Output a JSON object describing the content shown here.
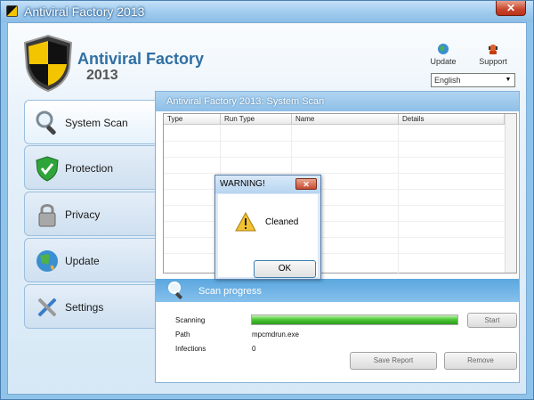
{
  "window": {
    "title": "Antiviral Factory 2013",
    "close_glyph": "✕"
  },
  "brand": {
    "name": "Antiviral Factory",
    "year": "2013",
    "icon": "shield-logo"
  },
  "top_buttons": {
    "update": {
      "label": "Update",
      "icon": "globe-icon"
    },
    "support": {
      "label": "Support",
      "icon": "support-icon"
    }
  },
  "language": {
    "selected": "English"
  },
  "sidebar": {
    "items": [
      {
        "label": "System Scan",
        "icon": "magnifier-icon",
        "active": true
      },
      {
        "label": "Protection",
        "icon": "shield-check-icon",
        "active": false
      },
      {
        "label": "Privacy",
        "icon": "lock-icon",
        "active": false
      },
      {
        "label": "Update",
        "icon": "globe-icon",
        "active": false
      },
      {
        "label": "Settings",
        "icon": "tools-icon",
        "active": false
      }
    ]
  },
  "panel": {
    "title": "Antiviral Factory 2013: System Scan",
    "columns": [
      "Type",
      "Run Type",
      "Name",
      "Details"
    ]
  },
  "progress": {
    "title": "Scan progress",
    "scanning_label": "Scanning",
    "path_label": "Path",
    "path_value": "mpcmdrun.exe",
    "infections_label": "Infections",
    "infections_value": "0",
    "progress_fraction": 1.0,
    "start_label": "Start",
    "save_report_label": "Save Report",
    "remove_label": "Remove"
  },
  "dialog": {
    "title": "WARNING!",
    "close_glyph": "✕",
    "message": "Cleaned",
    "ok_label": "OK",
    "icon": "warning-icon"
  },
  "colors": {
    "accent": "#5aa7df",
    "progress": "#4ec838",
    "brand_text": "#2f6fa3"
  }
}
